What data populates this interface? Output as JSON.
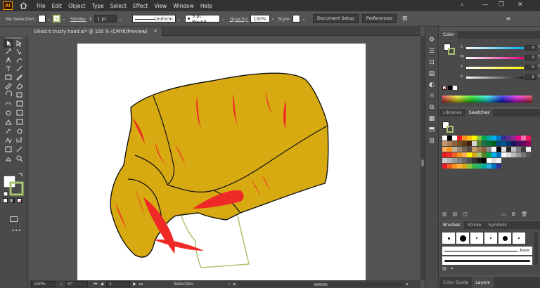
{
  "app": {
    "logo": "Ai"
  },
  "menubar": {
    "items": [
      "File",
      "Edit",
      "Object",
      "Type",
      "Select",
      "Effect",
      "View",
      "Window",
      "Help"
    ],
    "controls": [
      "—",
      "❐",
      "✕"
    ]
  },
  "control_bar": {
    "selection_label": "No Selection",
    "stroke_label": "Stroke:",
    "stroke_value": "1 pt",
    "stroke_profile": "Uniform",
    "brush": "5 pt. Round",
    "opacity_label": "Opacity:",
    "opacity_value": "100%",
    "style_label": "Style:",
    "document_setup": "Document Setup",
    "preferences": "Preferences"
  },
  "document": {
    "tab_title": "Ghost's trusty hand.ai* @ 150 % (CMYK/Preview)",
    "close": "✕"
  },
  "status_bar": {
    "zoom": "150%",
    "rotation": "0°",
    "artboard": "1",
    "tool": "Selection"
  },
  "color_panel": {
    "tab": "Color",
    "channels": [
      {
        "name": "C",
        "value": "0",
        "unit": "%",
        "color": "#00aeef"
      },
      {
        "name": "M",
        "value": "0",
        "unit": "%",
        "color": "#ec008c"
      },
      {
        "name": "Y",
        "value": "0",
        "unit": "%",
        "color": "#fff200"
      },
      {
        "name": "K",
        "value": "0",
        "unit": "%",
        "color": "#231f20"
      }
    ]
  },
  "swatches_panel": {
    "tabs": [
      "Libraries",
      "Swatches"
    ]
  },
  "brushes_panel": {
    "tabs": [
      "Brushes",
      "Stroke",
      "Symbols"
    ],
    "basic_label": "Basic"
  },
  "bottom_panel": {
    "tabs": [
      "Color Guide",
      "Layers"
    ]
  },
  "artwork_colors": {
    "hand_fill": "#d8aa12",
    "accent": "#ee2a27",
    "ghost_outline": "#a9c46c",
    "outline": "#111111"
  }
}
